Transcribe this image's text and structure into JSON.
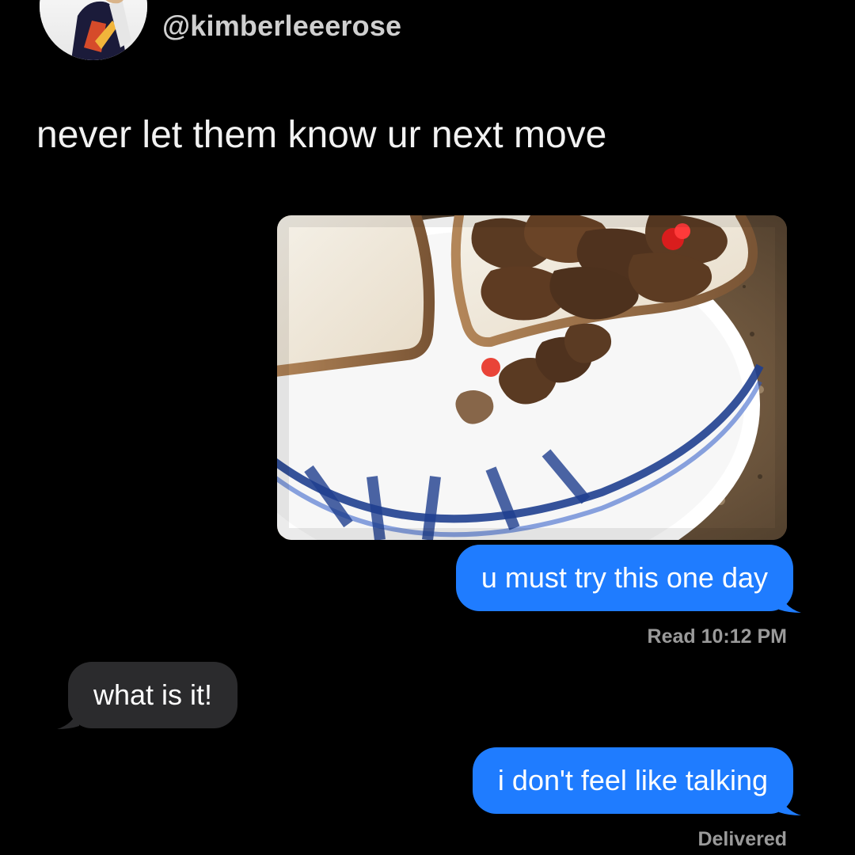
{
  "post": {
    "handle": "@kimberleeerose",
    "text": "never let them know ur next move"
  },
  "chat": {
    "photo_alt": "sandwich with steak pieces on a paper plate",
    "messages": [
      {
        "kind": "sent",
        "text": "u must try this one day"
      },
      {
        "kind": "recv",
        "text": "what is it!"
      },
      {
        "kind": "sent",
        "text": "i don't feel like talking"
      }
    ],
    "read_receipt": "Read 10:12 PM",
    "delivered_receipt": "Delivered"
  },
  "colors": {
    "background": "#000000",
    "sent_bubble": "#1f7cff",
    "received_bubble": "#2b2b2d",
    "receipt_text": "#9a9a9a"
  }
}
